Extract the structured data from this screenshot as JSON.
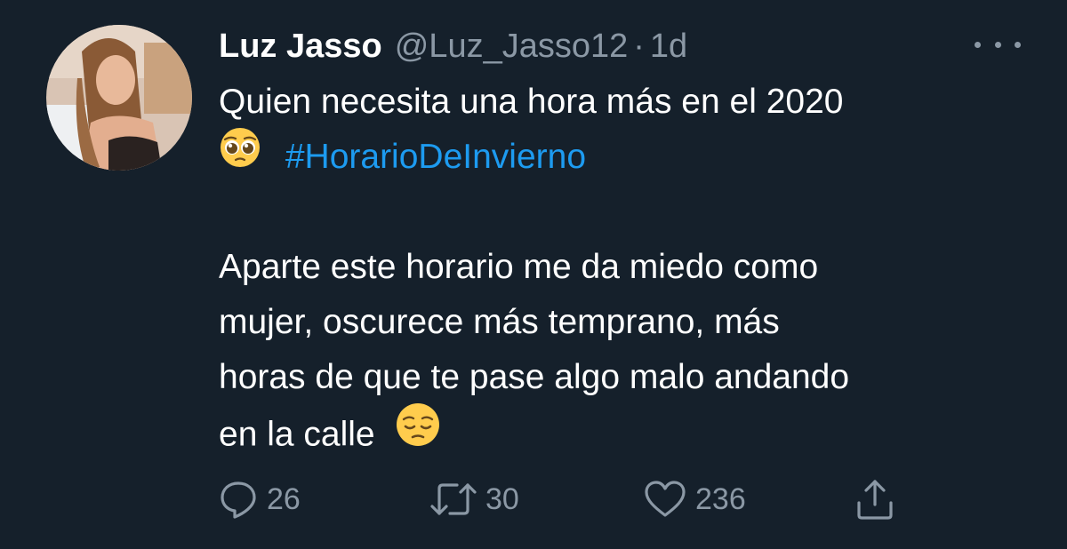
{
  "tweet": {
    "author_name": "Luz Jasso",
    "handle": "@Luz_Jasso12",
    "separator": "·",
    "time": "1d",
    "line1": "Quien necesita una hora más en el 2020",
    "hashtag": "#HorarioDeInvierno",
    "line3": "Aparte este horario me da miedo como",
    "line4": "mujer, oscurece más temprano, más",
    "line5": "horas de que te pase algo malo andando",
    "line6": "en la calle",
    "emoji_pleading": "pleading-face-emoji",
    "emoji_pensive": "pensive-face-emoji"
  },
  "actions": {
    "reply_count": "26",
    "retweet_count": "30",
    "like_count": "236"
  },
  "colors": {
    "background": "#15202b",
    "text": "#ffffff",
    "secondary": "#8b98a5",
    "link": "#1d9bf0"
  }
}
